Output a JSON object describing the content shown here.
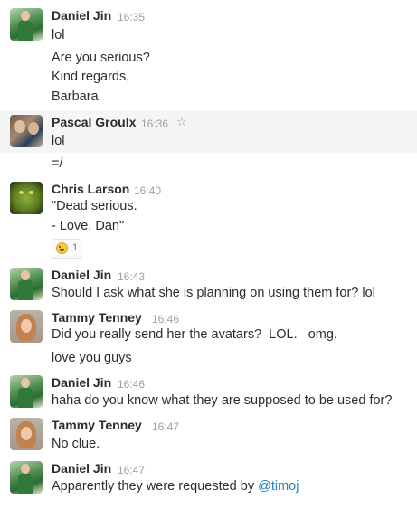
{
  "messages": [
    {
      "author": "Daniel Jin",
      "time": "16:35",
      "avatar": "daniel-avatar",
      "lines": [
        "lol",
        "Are you serious?",
        "Kind regards,",
        "Barbara"
      ]
    },
    {
      "author": "Pascal Groulx",
      "time": "16:36",
      "avatar": "pascal-avatar",
      "star_icon": "star-icon",
      "lines": [
        "lol",
        "=/"
      ]
    },
    {
      "author": "Chris Larson",
      "time": "16:40",
      "avatar": "chris-avatar",
      "lines": [
        "\"Dead serious.",
        "- Love, Dan\""
      ],
      "reaction": {
        "emoji": "joy-emoji-icon",
        "count": "1"
      }
    },
    {
      "author": "Daniel Jin",
      "time": "16:43",
      "avatar": "daniel-avatar",
      "lines": [
        "Should I ask what she is planning on using them for? lol"
      ]
    },
    {
      "author": "Tammy Tenney",
      "time": "16:46",
      "avatar": "tammy-avatar",
      "lines": [
        "Did you really send her the avatars?  LOL.   omg.",
        "love you guys"
      ]
    },
    {
      "author": "Daniel Jin",
      "time": "16:46",
      "avatar": "daniel-avatar",
      "lines": [
        "haha do you know what they are supposed to be used for?"
      ]
    },
    {
      "author": "Tammy Tenney",
      "time": "16:47",
      "avatar": "tammy-avatar",
      "lines": [
        "No clue."
      ]
    },
    {
      "author": "Daniel Jin",
      "time": "16:47",
      "avatar": "daniel-avatar",
      "lines": [
        "Apparently they were requested by "
      ],
      "mention": "@timoj"
    }
  ],
  "colors": {
    "mention": "#2a80b9",
    "timestamp": "#a0a0a2",
    "hover_bg": "#f5f5f5"
  }
}
